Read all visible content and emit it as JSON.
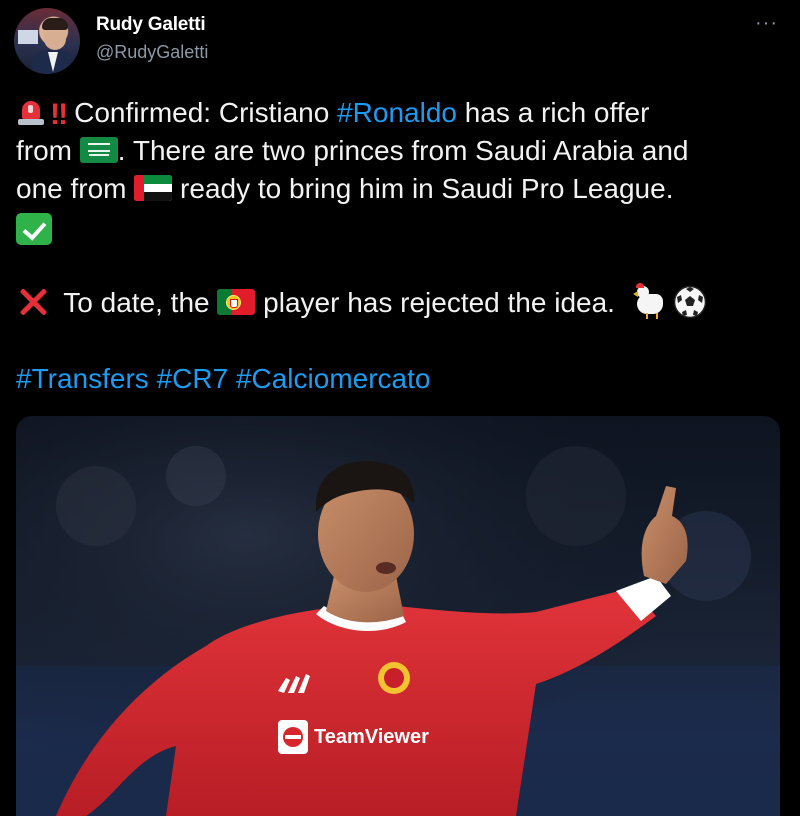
{
  "author": {
    "display_name": "Rudy Galetti",
    "handle": "@RudyGaletti"
  },
  "menu_icon": "more-horizontal-icon",
  "tweet": {
    "line1_text": "Confirmed: Cristiano ",
    "line1_hashtag": "#Ronaldo",
    "line1_tail": " has a rich offer",
    "line2_start": "from ",
    "line2_tail": ". There are two princes from Saudi Arabia and",
    "line3_start": "one from ",
    "line3_tail": " ready to bring him in Saudi Pro League.",
    "line5_start": " To date, the ",
    "line5_tail": " player has rejected the idea. ",
    "hashtags": [
      "#Transfers",
      "#CR7",
      "#Calciomercato"
    ]
  },
  "emojis": {
    "siren": "police-light-icon",
    "bangs": "‼",
    "saudi_flag": "saudi-arabia-flag-icon",
    "uae_flag": "uae-flag-icon",
    "check": "check-mark-button-icon",
    "cross": "cross-mark-icon",
    "portugal_flag": "portugal-flag-icon",
    "chicken": "chicken-icon",
    "ball": "soccer-ball-icon"
  },
  "media": {
    "shirt_sponsor": "TeamViewer",
    "kit_brand": "adidas"
  },
  "colors": {
    "background": "#000000",
    "text": "#e7e9ea",
    "hashtag": "#1d9bf0",
    "muted": "#8b98a5",
    "jersey": "#d8262d"
  }
}
